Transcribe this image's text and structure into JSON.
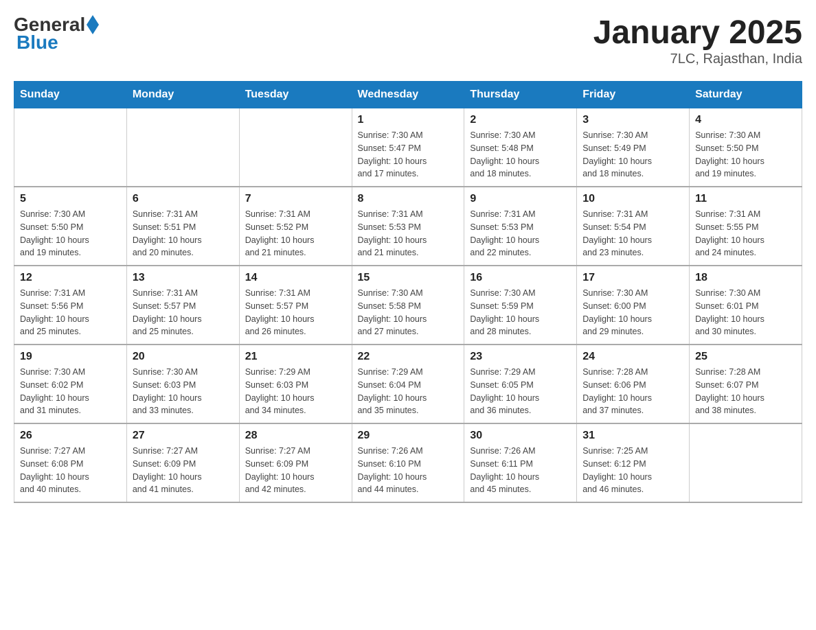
{
  "logo": {
    "general": "General",
    "blue": "Blue"
  },
  "title": "January 2025",
  "subtitle": "7LC, Rajasthan, India",
  "weekdays": [
    "Sunday",
    "Monday",
    "Tuesday",
    "Wednesday",
    "Thursday",
    "Friday",
    "Saturday"
  ],
  "weeks": [
    [
      {
        "day": "",
        "info": ""
      },
      {
        "day": "",
        "info": ""
      },
      {
        "day": "",
        "info": ""
      },
      {
        "day": "1",
        "info": "Sunrise: 7:30 AM\nSunset: 5:47 PM\nDaylight: 10 hours\nand 17 minutes."
      },
      {
        "day": "2",
        "info": "Sunrise: 7:30 AM\nSunset: 5:48 PM\nDaylight: 10 hours\nand 18 minutes."
      },
      {
        "day": "3",
        "info": "Sunrise: 7:30 AM\nSunset: 5:49 PM\nDaylight: 10 hours\nand 18 minutes."
      },
      {
        "day": "4",
        "info": "Sunrise: 7:30 AM\nSunset: 5:50 PM\nDaylight: 10 hours\nand 19 minutes."
      }
    ],
    [
      {
        "day": "5",
        "info": "Sunrise: 7:30 AM\nSunset: 5:50 PM\nDaylight: 10 hours\nand 19 minutes."
      },
      {
        "day": "6",
        "info": "Sunrise: 7:31 AM\nSunset: 5:51 PM\nDaylight: 10 hours\nand 20 minutes."
      },
      {
        "day": "7",
        "info": "Sunrise: 7:31 AM\nSunset: 5:52 PM\nDaylight: 10 hours\nand 21 minutes."
      },
      {
        "day": "8",
        "info": "Sunrise: 7:31 AM\nSunset: 5:53 PM\nDaylight: 10 hours\nand 21 minutes."
      },
      {
        "day": "9",
        "info": "Sunrise: 7:31 AM\nSunset: 5:53 PM\nDaylight: 10 hours\nand 22 minutes."
      },
      {
        "day": "10",
        "info": "Sunrise: 7:31 AM\nSunset: 5:54 PM\nDaylight: 10 hours\nand 23 minutes."
      },
      {
        "day": "11",
        "info": "Sunrise: 7:31 AM\nSunset: 5:55 PM\nDaylight: 10 hours\nand 24 minutes."
      }
    ],
    [
      {
        "day": "12",
        "info": "Sunrise: 7:31 AM\nSunset: 5:56 PM\nDaylight: 10 hours\nand 25 minutes."
      },
      {
        "day": "13",
        "info": "Sunrise: 7:31 AM\nSunset: 5:57 PM\nDaylight: 10 hours\nand 25 minutes."
      },
      {
        "day": "14",
        "info": "Sunrise: 7:31 AM\nSunset: 5:57 PM\nDaylight: 10 hours\nand 26 minutes."
      },
      {
        "day": "15",
        "info": "Sunrise: 7:30 AM\nSunset: 5:58 PM\nDaylight: 10 hours\nand 27 minutes."
      },
      {
        "day": "16",
        "info": "Sunrise: 7:30 AM\nSunset: 5:59 PM\nDaylight: 10 hours\nand 28 minutes."
      },
      {
        "day": "17",
        "info": "Sunrise: 7:30 AM\nSunset: 6:00 PM\nDaylight: 10 hours\nand 29 minutes."
      },
      {
        "day": "18",
        "info": "Sunrise: 7:30 AM\nSunset: 6:01 PM\nDaylight: 10 hours\nand 30 minutes."
      }
    ],
    [
      {
        "day": "19",
        "info": "Sunrise: 7:30 AM\nSunset: 6:02 PM\nDaylight: 10 hours\nand 31 minutes."
      },
      {
        "day": "20",
        "info": "Sunrise: 7:30 AM\nSunset: 6:03 PM\nDaylight: 10 hours\nand 33 minutes."
      },
      {
        "day": "21",
        "info": "Sunrise: 7:29 AM\nSunset: 6:03 PM\nDaylight: 10 hours\nand 34 minutes."
      },
      {
        "day": "22",
        "info": "Sunrise: 7:29 AM\nSunset: 6:04 PM\nDaylight: 10 hours\nand 35 minutes."
      },
      {
        "day": "23",
        "info": "Sunrise: 7:29 AM\nSunset: 6:05 PM\nDaylight: 10 hours\nand 36 minutes."
      },
      {
        "day": "24",
        "info": "Sunrise: 7:28 AM\nSunset: 6:06 PM\nDaylight: 10 hours\nand 37 minutes."
      },
      {
        "day": "25",
        "info": "Sunrise: 7:28 AM\nSunset: 6:07 PM\nDaylight: 10 hours\nand 38 minutes."
      }
    ],
    [
      {
        "day": "26",
        "info": "Sunrise: 7:27 AM\nSunset: 6:08 PM\nDaylight: 10 hours\nand 40 minutes."
      },
      {
        "day": "27",
        "info": "Sunrise: 7:27 AM\nSunset: 6:09 PM\nDaylight: 10 hours\nand 41 minutes."
      },
      {
        "day": "28",
        "info": "Sunrise: 7:27 AM\nSunset: 6:09 PM\nDaylight: 10 hours\nand 42 minutes."
      },
      {
        "day": "29",
        "info": "Sunrise: 7:26 AM\nSunset: 6:10 PM\nDaylight: 10 hours\nand 44 minutes."
      },
      {
        "day": "30",
        "info": "Sunrise: 7:26 AM\nSunset: 6:11 PM\nDaylight: 10 hours\nand 45 minutes."
      },
      {
        "day": "31",
        "info": "Sunrise: 7:25 AM\nSunset: 6:12 PM\nDaylight: 10 hours\nand 46 minutes."
      },
      {
        "day": "",
        "info": ""
      }
    ]
  ]
}
